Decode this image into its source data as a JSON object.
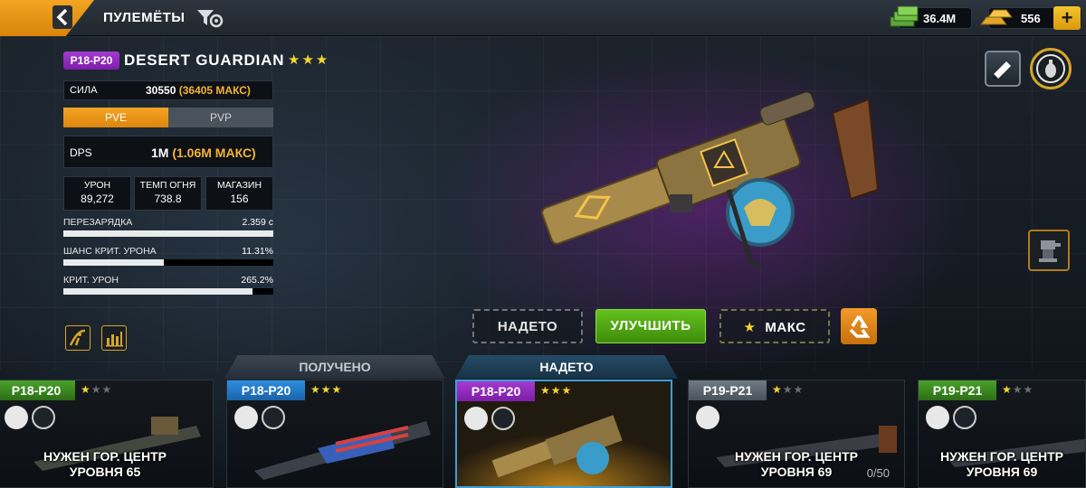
{
  "header": {
    "title": "ПУЛЕМЁТЫ",
    "cash": "36.4M",
    "gold": "556",
    "plus_label": "+"
  },
  "weapon": {
    "grade": "P18-P20",
    "name": "DESERT GUARDIAN",
    "stars": "★★★",
    "power_label": "СИЛА",
    "power_value": "30550",
    "power_max": "(36405 МАКС)",
    "mode_pve": "PVE",
    "mode_pvp": "PVP",
    "dps_label": "DPS",
    "dps_value": "1M",
    "dps_max": "(1.06M МАКС)",
    "stats": [
      {
        "label": "УРОН",
        "value": "89,272"
      },
      {
        "label": "ТЕМП ОГНЯ",
        "value": "738.8"
      },
      {
        "label": "МАГАЗИН",
        "value": "156"
      }
    ],
    "bars": [
      {
        "label": "ПЕРЕЗАРЯДКА",
        "value": "2.359 с",
        "fill": 1.0
      },
      {
        "label": "ШАНС КРИТ. УРОНА",
        "value": "11.31%",
        "fill": 0.48
      },
      {
        "label": "КРИТ. УРОН",
        "value": "265.2%",
        "fill": 0.9
      }
    ]
  },
  "actions": {
    "equipped": "НАДЕТО",
    "upgrade": "УЛУЧШИТЬ",
    "max": "МАКС",
    "max_star": "★"
  },
  "tabs": {
    "owned": "ПОЛУЧЕНО",
    "equipped": "НАДЕТО"
  },
  "cards": [
    {
      "grade": "P18-P20",
      "stars_on": "★",
      "stars_off": "★★",
      "req_line1": "НУЖЕН ГОР. ЦЕНТР",
      "req_line2": "УРОВНЯ 65",
      "progress": ""
    },
    {
      "grade": "P18-P20",
      "stars_on": "★★★",
      "stars_off": "",
      "req_line1": "",
      "req_line2": "",
      "progress": ""
    },
    {
      "grade": "P18-P20",
      "stars_on": "★★★",
      "stars_off": "",
      "req_line1": "",
      "req_line2": "",
      "progress": ""
    },
    {
      "grade": "P19-P21",
      "stars_on": "★",
      "stars_off": "★★",
      "req_line1": "НУЖЕН ГОР. ЦЕНТР",
      "req_line2": "УРОВНЯ 69",
      "progress": "0/50"
    },
    {
      "grade": "P19-P21",
      "stars_on": "★",
      "stars_off": "★★",
      "req_line1": "НУЖЕН ГОР. ЦЕНТР",
      "req_line2": "УРОВНЯ 69",
      "progress": ""
    }
  ],
  "colors": {
    "accent_orange": "#f2a522",
    "upgrade_green": "#4fa514",
    "grade_purple": "#8e2bbb",
    "grade_blue": "#2478c8",
    "grade_green": "#3a8a20",
    "grade_grey": "#5c646c",
    "star_gold": "#f5d631"
  },
  "icons": {
    "back": "chevron-left-icon",
    "filter": "filter-gear-icon",
    "cash": "cash-stack-icon",
    "gold": "gold-bars-icon",
    "skin": "skin-brush-icon",
    "mod": "grenade-mod-icon",
    "recycle": "recycle-icon",
    "info": "info-icon",
    "compare": "chart-icon"
  }
}
